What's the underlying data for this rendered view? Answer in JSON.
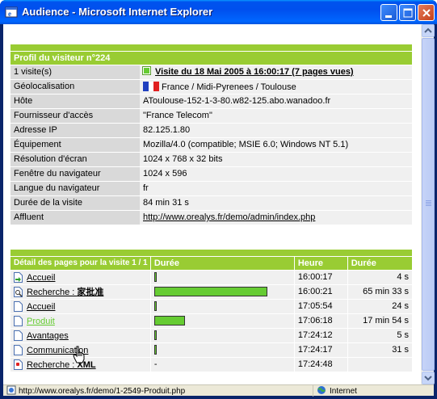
{
  "window": {
    "title": "Audience - Microsoft Internet Explorer"
  },
  "visitor": {
    "header": "Profil du visiteur n°224",
    "rows": [
      {
        "label": "1 visite(s)",
        "value": "Visite du 18 Mai 2005 à 16:00:17 (7 pages vues)",
        "type": "visit-link"
      },
      {
        "label": "Géolocalisation",
        "value": "France / Midi-Pyrenees / Toulouse",
        "type": "geo"
      },
      {
        "label": "Hôte",
        "value": "AToulouse-152-1-3-80.w82-125.abo.wanadoo.fr",
        "type": "text"
      },
      {
        "label": "Fournisseur d'accès",
        "value": "\"France Telecom\"",
        "type": "text"
      },
      {
        "label": "Adresse IP",
        "value": "82.125.1.80",
        "type": "text"
      },
      {
        "label": "Équipement",
        "value": "Mozilla/4.0 (compatible; MSIE 6.0; Windows NT 5.1)",
        "type": "text"
      },
      {
        "label": "Résolution d'écran",
        "value": "1024 x 768 x 32 bits",
        "type": "text"
      },
      {
        "label": "Fenêtre du navigateur",
        "value": "1024 x 596",
        "type": "text"
      },
      {
        "label": "Langue du navigateur",
        "value": "fr",
        "type": "text"
      },
      {
        "label": "Durée de la visite",
        "value": "84 min 31 s",
        "type": "text"
      },
      {
        "label": "Affluent",
        "value": "http://www.orealys.fr/demo/admin/index.php",
        "type": "link"
      }
    ]
  },
  "pages": {
    "headers": [
      "Détail des pages pour la visite 1 / 1",
      "Durée",
      "Heure",
      "Durée"
    ],
    "rows": [
      {
        "page": "Accueil",
        "prefix": "",
        "query": "",
        "icon": "page-enter-icon",
        "bar": 0.01,
        "heure": "16:00:17",
        "duree": "4 s"
      },
      {
        "page": "Recherche : ",
        "prefix": "Recherche : ",
        "query": "家批准",
        "icon": "search-page-icon",
        "bar": 1.0,
        "heure": "16:00:21",
        "duree": "65 min 33 s"
      },
      {
        "page": "Accueil",
        "prefix": "",
        "query": "",
        "icon": "page-icon",
        "bar": 0.01,
        "heure": "17:05:54",
        "duree": "24 s"
      },
      {
        "page": "Produit",
        "prefix": "",
        "query": "",
        "icon": "page-icon",
        "bar": 0.27,
        "heure": "17:06:18",
        "duree": "17 min 54 s"
      },
      {
        "page": "Avantages",
        "prefix": "",
        "query": "",
        "icon": "page-icon",
        "bar": 0.01,
        "heure": "17:24:12",
        "duree": "5 s"
      },
      {
        "page": "Communication",
        "prefix": "",
        "query": "",
        "icon": "page-icon",
        "bar": 0.01,
        "heure": "17:24:17",
        "duree": "31 s"
      },
      {
        "page": "Recherche : ",
        "prefix": "Recherche : ",
        "query": "XML",
        "icon": "page-exit-icon",
        "bar": null,
        "bar_text": "-",
        "heure": "17:24:48",
        "duree": ""
      }
    ]
  },
  "status": {
    "url": "http://www.orealys.fr/demo/1-2549-Produit.php",
    "zone": "Internet"
  },
  "colors": {
    "header_green": "#99cc33",
    "bar_green": "#66cc33",
    "xp_blue": "#0053ee"
  }
}
